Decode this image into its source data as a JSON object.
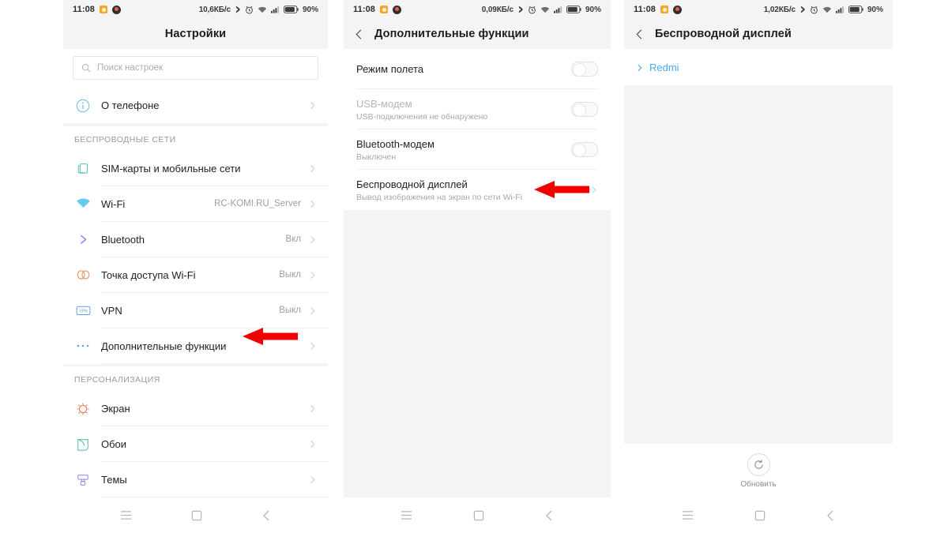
{
  "meta": {
    "accent_blue": "#4aa9f0",
    "arrow_red": "#f20000",
    "panel_bg": "#f4f4f4"
  },
  "panels": [
    {
      "id": "settings",
      "status_bar": {
        "time": "11:08",
        "speed": "10,6КБ/c",
        "battery_percent": "90%",
        "icons": [
          "mi-app-icon",
          "dark-app-icon",
          "bluetooth-icon",
          "alarm-icon",
          "wifi-icon",
          "signal-icon",
          "battery-icon"
        ]
      },
      "title": "Настройки",
      "search": {
        "placeholder": "Поиск настроек",
        "icon": "search-icon"
      },
      "groups": [
        {
          "header": "",
          "rows": [
            {
              "icon": "info-circle-icon",
              "icon_color": "#6fb7e8",
              "label": "О телефоне",
              "value": "",
              "chevron": true
            }
          ]
        },
        {
          "header": "БЕСПРОВОДНЫЕ СЕТИ",
          "rows": [
            {
              "icon": "sim-card-icon",
              "icon_color": "#5fc0ab",
              "label": "SIM-карты и мобильные сети",
              "value": "",
              "chevron": true
            },
            {
              "icon": "wifi-icon",
              "icon_color": "#4fc3e8",
              "label": "Wi-Fi",
              "value": "RC-KOMI.RU_Server",
              "chevron": true
            },
            {
              "icon": "bluetooth-icon",
              "icon_color": "#9b8df0",
              "label": "Bluetooth",
              "value": "Вкл",
              "chevron": true
            },
            {
              "icon": "hotspot-icon",
              "icon_color": "#f08a5d",
              "label": "Точка доступа Wi-Fi",
              "value": "Выкл",
              "chevron": true
            },
            {
              "icon": "vpn-icon",
              "icon_color": "#6c9ee8",
              "label": "VPN",
              "value": "Выкл",
              "chevron": true
            },
            {
              "icon": "more-dots-icon",
              "icon_color": "#6c9ee8",
              "label": "Дополнительные функции",
              "value": "",
              "chevron": true
            }
          ]
        },
        {
          "header": "ПЕРСОНАЛИЗАЦИЯ",
          "rows": [
            {
              "icon": "brightness-icon",
              "icon_color": "#f0754a",
              "label": "Экран",
              "value": "",
              "chevron": true
            },
            {
              "icon": "wallpaper-icon",
              "icon_color": "#5fc0ab",
              "label": "Обои",
              "value": "",
              "chevron": true
            },
            {
              "icon": "themes-icon",
              "icon_color": "#9b8df0",
              "label": "Темы",
              "value": "",
              "chevron": true
            }
          ]
        }
      ],
      "nav": [
        "menu-icon",
        "home-icon",
        "back-icon"
      ]
    },
    {
      "id": "additional-settings",
      "status_bar": {
        "time": "11:08",
        "speed": "0,09КБ/c",
        "battery_percent": "90%"
      },
      "title": "Дополнительные функции",
      "back_icon": "back-chevron-icon",
      "rows": [
        {
          "title": "Режим полета",
          "subtitle": "",
          "control": "toggle",
          "toggle_on": false,
          "dim": false
        },
        {
          "title": "USB-модем",
          "subtitle": "USB-подключения не обнаружено",
          "control": "toggle",
          "toggle_on": false,
          "dim": true
        },
        {
          "title": "Bluetooth-модем",
          "subtitle": "Выключен",
          "control": "toggle",
          "toggle_on": false,
          "dim": false
        },
        {
          "title": "Беспроводной дисплей",
          "subtitle": "Вывод изображения на экран по сети Wi-Fi",
          "control": "chevron",
          "toggle_on": false,
          "dim": false
        }
      ],
      "nav": [
        "menu-icon",
        "home-icon",
        "back-icon"
      ]
    },
    {
      "id": "wireless-display",
      "status_bar": {
        "time": "11:08",
        "speed": "1,02КБ/c",
        "battery_percent": "90%"
      },
      "title": "Беспроводной дисплей",
      "back_icon": "back-chevron-icon",
      "device": {
        "name": "Redmi",
        "chevron_icon": "chevron-right-icon"
      },
      "refresh": {
        "label": "Обновить",
        "icon": "refresh-icon"
      },
      "nav": [
        "menu-icon",
        "home-icon",
        "back-icon"
      ]
    }
  ],
  "annotations": [
    {
      "name": "arrow-to-additional-settings",
      "target": "Дополнительные функции"
    },
    {
      "name": "arrow-to-wireless-display",
      "target": "Беспроводной дисплей"
    }
  ]
}
